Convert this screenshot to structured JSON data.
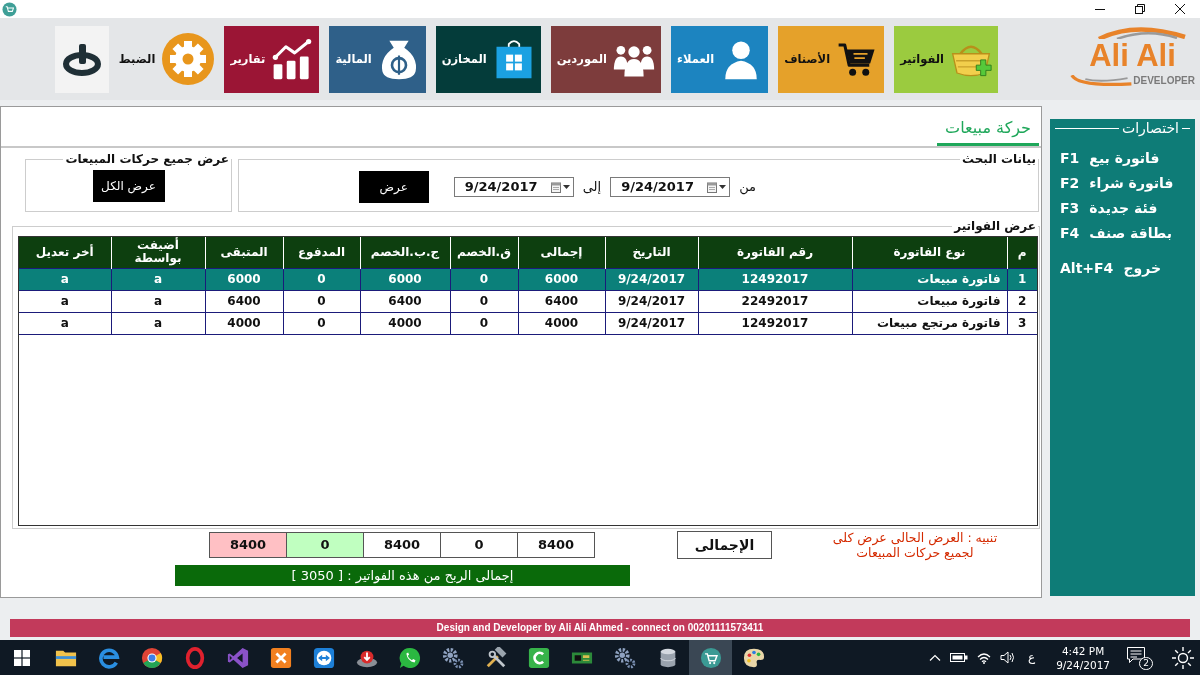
{
  "toolbar": {
    "logo": {
      "name": "Ali Ali",
      "subtitle": "DEVELOPER"
    },
    "tiles": [
      {
        "kind": "basket",
        "label": "الفواتير",
        "color": "#9bcb3f"
      },
      {
        "kind": "cart",
        "label": "الأصناف",
        "color": "#e5a12a"
      },
      {
        "kind": "person",
        "label": "العملاء",
        "color": "#1c84c0"
      },
      {
        "kind": "people",
        "label": "الموردين",
        "color": "#7d3c3c"
      },
      {
        "kind": "store",
        "label": "المخازن",
        "color": "#043c3a"
      },
      {
        "kind": "moneybag",
        "label": "المالية",
        "color": "#2f6089"
      },
      {
        "kind": "chart",
        "label": "تقارير",
        "color": "#9b1535"
      },
      {
        "kind": "gear",
        "label": "الضبط",
        "color": "#e8961c"
      },
      {
        "kind": "power",
        "color": "#f3f3f3"
      }
    ]
  },
  "tabs": [
    {
      "label": "حركة مبيعات",
      "selected": true
    }
  ],
  "search": {
    "title": "بيانات البحث",
    "from_label": "من",
    "from_date": "9/24/2017",
    "to_label": "إلى",
    "to_date": "9/24/2017",
    "button": "عرض"
  },
  "show_all": {
    "title": "عرض جميع حركات المبيعات",
    "button": "عرض الكل"
  },
  "invoices": {
    "title": "عرض الفواتير",
    "columns": [
      "م",
      "نوع الفاتورة",
      "رقم الفاتورة",
      "التاريخ",
      "إجمالى",
      "ق.الخصم",
      "ج.ب.الخصم",
      "المدفوع",
      "المتبقى",
      "أضيفت\nبواسطة",
      "أخر تعديل"
    ],
    "rows": [
      {
        "selected": true,
        "cells": [
          "1",
          "فاتورة مبيعات",
          "12492017",
          "9/24/2017",
          "6000",
          "0",
          "6000",
          "0",
          "6000",
          "a",
          "a"
        ]
      },
      {
        "selected": false,
        "cells": [
          "2",
          "فاتورة مبيعات",
          "22492017",
          "9/24/2017",
          "6400",
          "0",
          "6400",
          "0",
          "6400",
          "a",
          "a"
        ]
      },
      {
        "selected": false,
        "cells": [
          "3",
          "فاتورة مرتجع مبيعات",
          "12492017",
          "9/24/2017",
          "4000",
          "0",
          "4000",
          "0",
          "4000",
          "a",
          "a"
        ]
      }
    ]
  },
  "totals": {
    "notice": "تنبيه : العرض الحالى عرض كلى\nلجميع حركات المبيعات",
    "button": "الإجمالى",
    "values": [
      {
        "value": "8400",
        "color": "#ffffff"
      },
      {
        "value": "0",
        "color": "#ffffff"
      },
      {
        "value": "8400",
        "color": "#ffffff"
      },
      {
        "value": "0",
        "color": "#c0ffc0"
      },
      {
        "value": "8400",
        "color": "#ffc0c4"
      }
    ],
    "profit": "إجمالى الربح من هذه الفواتير : [ 3050 ]"
  },
  "shortcuts": {
    "title": "اختصارات",
    "items": [
      {
        "key": "F1",
        "label": "فاتورة بيع"
      },
      {
        "key": "F2",
        "label": "فاتورة شراء"
      },
      {
        "key": "F3",
        "label": "فئة جديدة"
      },
      {
        "key": "F4",
        "label": "بطاقة صنف"
      }
    ],
    "exit": {
      "key": "Alt+F4",
      "label": "خروج"
    }
  },
  "footer": "Design and Developer by Ali Ali Ahmed - connect on 00201111573411",
  "taskbar": {
    "apps": [
      {
        "kind": "folder",
        "selected": false
      },
      {
        "kind": "swirl",
        "selected": false
      },
      {
        "kind": "wheel",
        "selected": false
      },
      {
        "kind": "ring",
        "selected": false
      },
      {
        "kind": "ribbon",
        "selected": false
      },
      {
        "kind": "square",
        "selected": false
      },
      {
        "kind": "arrows",
        "selected": false
      },
      {
        "kind": "download",
        "selected": false
      },
      {
        "kind": "chat",
        "selected": false
      },
      {
        "kind": "gears",
        "selected": false
      },
      {
        "kind": "tools",
        "selected": false
      },
      {
        "kind": "arc",
        "selected": false
      },
      {
        "kind": "board",
        "selected": false
      },
      {
        "kind": "gears",
        "selected": false
      },
      {
        "kind": "database",
        "selected": false
      },
      {
        "kind": "cartapp",
        "selected": true
      },
      {
        "kind": "palette",
        "selected": false
      }
    ],
    "tray": {
      "language": "ع",
      "time": "4:42 PM",
      "date": "9/24/2017",
      "notifications": "2"
    }
  }
}
